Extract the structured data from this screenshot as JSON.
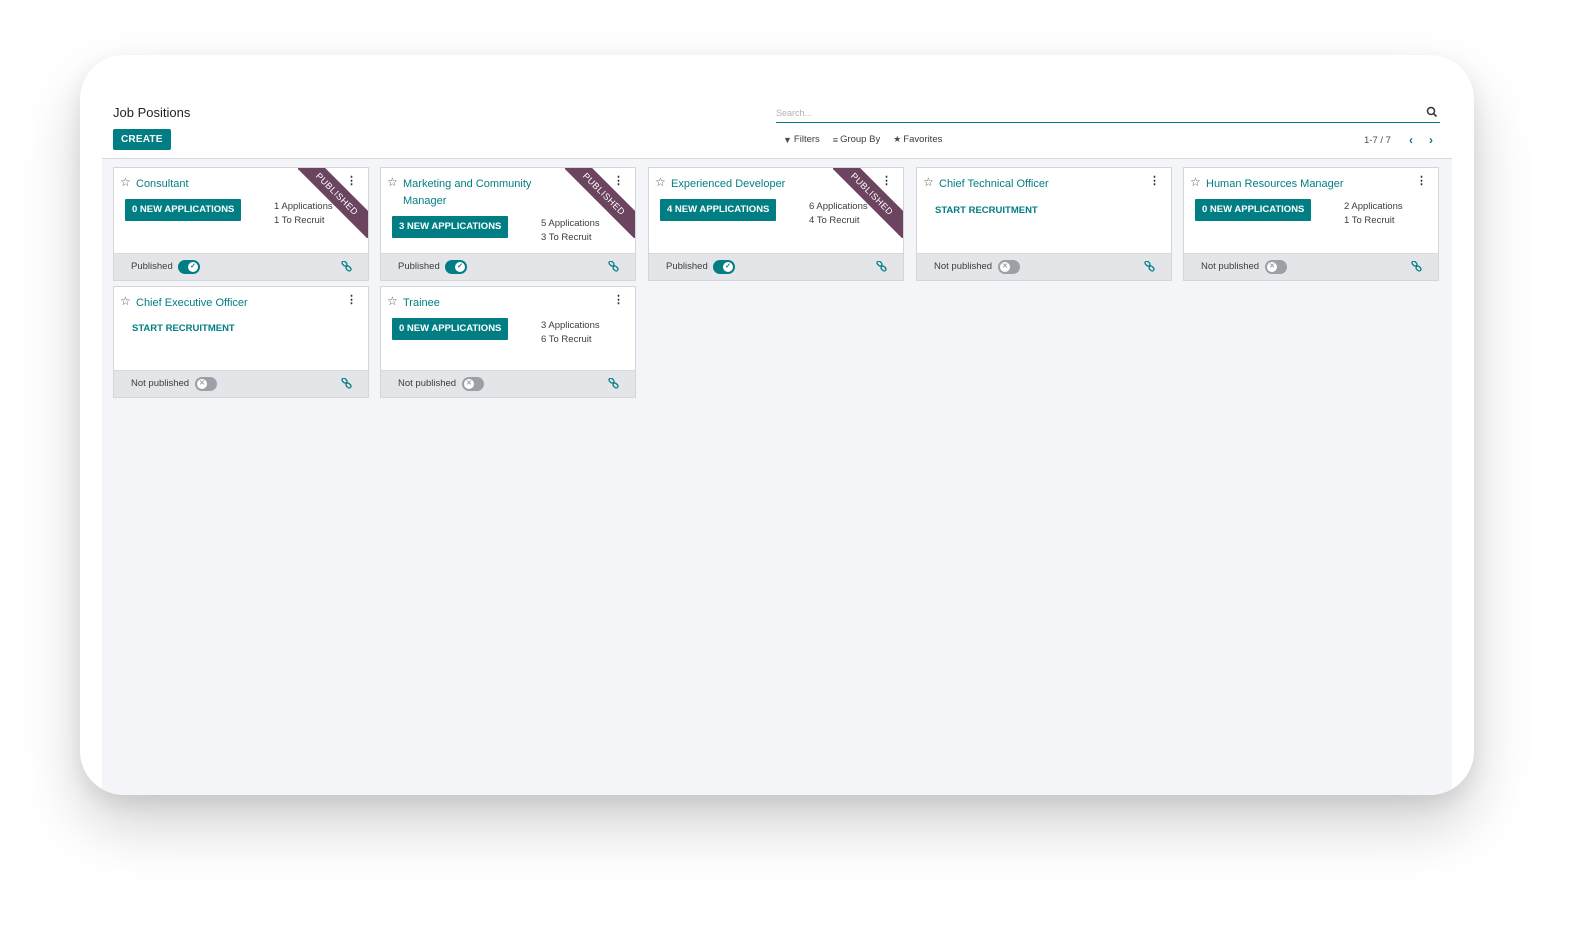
{
  "header": {
    "title": "Job Positions",
    "create_label": "CREATE"
  },
  "search": {
    "placeholder": "Search..."
  },
  "search_panel": {
    "filters_label": "Filters",
    "groupby_label": "Group By",
    "favorites_label": "Favorites"
  },
  "pager": {
    "value": "1-7 / 7"
  },
  "colors": {
    "accent": "#017e84",
    "ribbon": "#6b4460",
    "background": "#f4f5f9"
  },
  "cards": [
    {
      "title": "Consultant",
      "new_applications": "0 NEW APPLICATIONS",
      "applications": "1 Applications",
      "to_recruit": "1 To Recruit",
      "ribbon": "PUBLISHED",
      "status": "Published",
      "published": true
    },
    {
      "title": "Marketing and Community Manager",
      "new_applications": "3 NEW APPLICATIONS",
      "applications": "5 Applications",
      "to_recruit": "3 To Recruit",
      "ribbon": "PUBLISHED",
      "status": "Published",
      "published": true
    },
    {
      "title": "Experienced Developer",
      "new_applications": "4 NEW APPLICATIONS",
      "applications": "6 Applications",
      "to_recruit": "4 To Recruit",
      "ribbon": "PUBLISHED",
      "status": "Published",
      "published": true
    },
    {
      "title": "Chief Technical Officer",
      "start_recruitment": "START RECRUITMENT",
      "status": "Not published",
      "published": false
    },
    {
      "title": "Human Resources Manager",
      "new_applications": "0 NEW APPLICATIONS",
      "applications": "2 Applications",
      "to_recruit": "1 To Recruit",
      "status": "Not published",
      "published": false
    },
    {
      "title": "Chief Executive Officer",
      "start_recruitment": "START RECRUITMENT",
      "status": "Not published",
      "published": false
    },
    {
      "title": "Trainee",
      "new_applications": "0 NEW APPLICATIONS",
      "applications": "3 Applications",
      "to_recruit": "6 To Recruit",
      "status": "Not published",
      "published": false
    }
  ]
}
